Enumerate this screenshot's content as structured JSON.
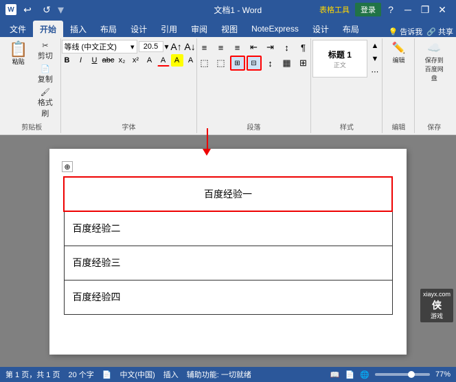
{
  "titleBar": {
    "docName": "文档1 - Word",
    "tableTools": "表格工具",
    "loginBtn": "登录",
    "undoIcon": "↩",
    "redoIcon": "↺",
    "minBtn": "─",
    "maxBtn": "□",
    "closeBtn": "✕",
    "restoreBtn": "❐"
  },
  "ribbonTabs": {
    "tabs": [
      "文件",
      "开始",
      "插入",
      "布局",
      "设计",
      "引用",
      "审阅",
      "视图",
      "NoteExpress",
      "设计",
      "布局"
    ],
    "activeTab": "开始",
    "rightItems": [
      "告诉我",
      "共享"
    ]
  },
  "clipboard": {
    "groupLabel": "剪贴板",
    "pasteLabel": "粘贴",
    "cutLabel": "剪切",
    "copyLabel": "复制",
    "formatPainterLabel": "格式刷"
  },
  "font": {
    "groupLabel": "字体",
    "fontName": "等线 (中文正文)",
    "fontSize": "20.5",
    "boldLabel": "B",
    "italicLabel": "I",
    "underlineLabel": "U",
    "strikeLabel": "abc",
    "subLabel": "x₂",
    "supLabel": "x²",
    "clearLabel": "A",
    "colorLabel": "A",
    "hiLabel": "A"
  },
  "paragraph": {
    "groupLabel": "段落",
    "listBulletLabel": "≡",
    "listNumberLabel": "≡",
    "listMultiLabel": "≡",
    "decreaseIndentLabel": "⇤",
    "increaseIndentLabel": "⇥",
    "alignLeftLabel": "≡",
    "alignCenterLabel": "≡",
    "alignRightLabel": "≡",
    "alignJustifyLabel": "≡",
    "lineSpacingLabel": "↕",
    "shadingLabel": "▦",
    "borderLabel": "⊞",
    "highlightedBtn": "borderBtn"
  },
  "styles": {
    "groupLabel": "样式",
    "label": "样式"
  },
  "editing": {
    "groupLabel": "编辑",
    "label": "编辑"
  },
  "save": {
    "groupLabel": "保存",
    "label": "保存到\n百度网盘",
    "label2": "保存"
  },
  "document": {
    "tableRows": [
      {
        "cells": [
          "百度经验一"
        ],
        "isHeader": true
      },
      {
        "cells": [
          "百度经验二"
        ],
        "isHeader": false
      },
      {
        "cells": [
          "百度经验三"
        ],
        "isHeader": false
      },
      {
        "cells": [
          "百度经验四"
        ],
        "isHeader": false
      }
    ]
  },
  "statusBar": {
    "pageInfo": "第 1 页，共 1 页",
    "wordCount": "20 个字",
    "language": "中文(中国)",
    "insertMode": "插入",
    "accessibility": "辅助功能: 一切就绪",
    "zoomLevel": "77%",
    "watermark": "xiayx.com\n侠游戏"
  }
}
